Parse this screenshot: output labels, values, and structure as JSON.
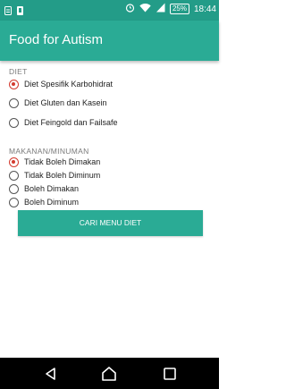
{
  "status_bar": {
    "battery": "25%",
    "time": "18:44"
  },
  "app_bar": {
    "title": "Food for Autism"
  },
  "diet": {
    "label": "DIET",
    "options": [
      {
        "label": "Diet Spesifik Karbohidrat",
        "checked": true
      },
      {
        "label": "Diet Gluten dan Kasein",
        "checked": false
      },
      {
        "label": "Diet Feingold dan Failsafe",
        "checked": false
      }
    ]
  },
  "makanan": {
    "label": "MAKANAN/MINUMAN",
    "options": [
      {
        "label": "Tidak Boleh Dimakan",
        "checked": true
      },
      {
        "label": "Tidak Boleh Diminum",
        "checked": false
      },
      {
        "label": "Boleh Dimakan",
        "checked": false
      },
      {
        "label": "Boleh Diminum",
        "checked": false
      }
    ]
  },
  "button": {
    "label": "CARI MENU DIET"
  },
  "colors": {
    "primary": "#2aab95",
    "primary_dark": "#239c88",
    "radio_accent": "#d33a2f"
  },
  "icons": {
    "status_left": [
      "sim-icon",
      "notification-icon"
    ],
    "status_right": [
      "alarm-icon",
      "wifi-icon",
      "signal-icon",
      "battery-icon"
    ],
    "nav": [
      "back-icon",
      "home-icon",
      "recents-icon"
    ]
  }
}
